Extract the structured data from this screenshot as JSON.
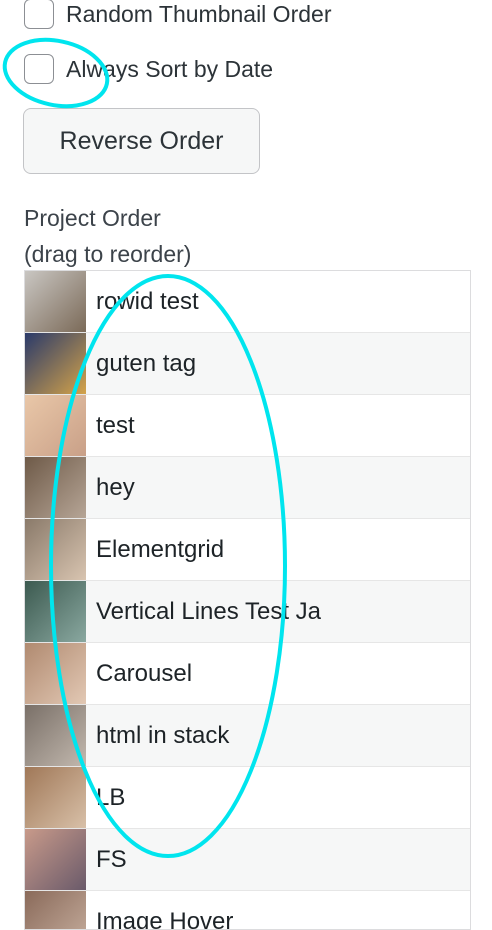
{
  "checkboxes": {
    "random_thumbnail_order": "Random Thumbnail Order",
    "always_sort_by_date": "Always Sort by Date"
  },
  "buttons": {
    "reverse_order": "Reverse Order"
  },
  "project_order": {
    "label_line1": "Project Order",
    "label_line2": "(drag to reorder)",
    "items": [
      {
        "label": "rowid test",
        "thumb_colors": [
          "#c9c6c2",
          "#7b6a58"
        ]
      },
      {
        "label": "guten tag",
        "thumb_colors": [
          "#2a3a6a",
          "#d4a34a"
        ]
      },
      {
        "label": "test",
        "thumb_colors": [
          "#e9c7a8",
          "#c9a088"
        ]
      },
      {
        "label": "hey",
        "thumb_colors": [
          "#6e5a48",
          "#b6a596"
        ]
      },
      {
        "label": "Elementgrid",
        "thumb_colors": [
          "#8a7a6a",
          "#d8c4b0"
        ]
      },
      {
        "label": "Vertical Lines Test Ja",
        "thumb_colors": [
          "#3c5a50",
          "#8aa8a0"
        ]
      },
      {
        "label": "Carousel",
        "thumb_colors": [
          "#b08a70",
          "#e2c8b4"
        ]
      },
      {
        "label": "html in stack",
        "thumb_colors": [
          "#7a7068",
          "#c2b8ae"
        ]
      },
      {
        "label": "LB",
        "thumb_colors": [
          "#a07858",
          "#d8c0a8"
        ]
      },
      {
        "label": "FS",
        "thumb_colors": [
          "#c89a8a",
          "#6a5a6a"
        ]
      },
      {
        "label": "Image Hover",
        "thumb_colors": [
          "#8a6a5a",
          "#c8b0a0"
        ]
      }
    ]
  },
  "annotation_color": "#00e5ee"
}
